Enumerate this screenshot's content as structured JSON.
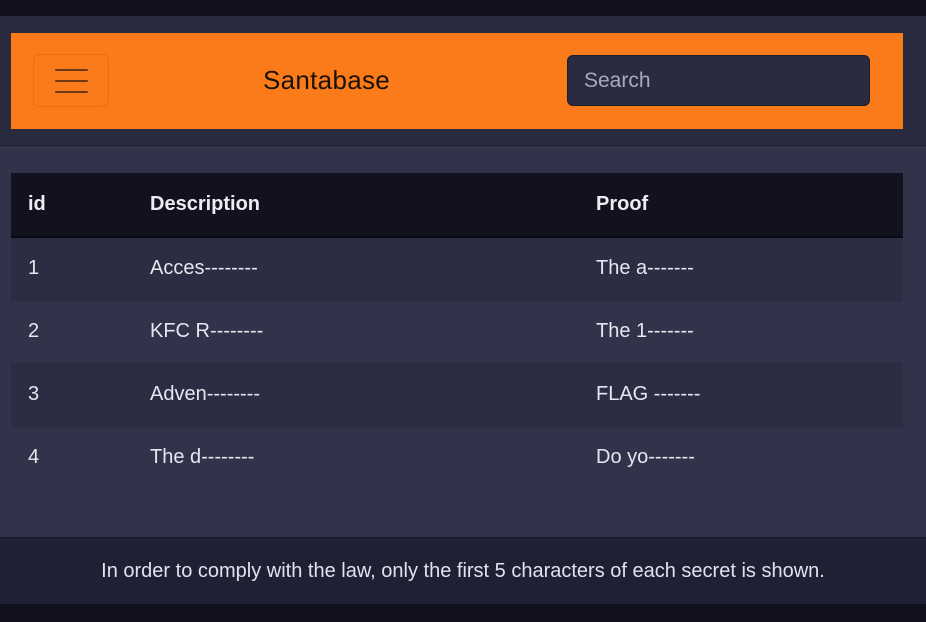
{
  "navbar": {
    "brand": "Santabase",
    "search_placeholder": "Search",
    "search_value": "",
    "accent_color": "#fb7a1a",
    "menu_icon": "hamburger-menu-icon"
  },
  "table": {
    "columns": [
      "id",
      "Description",
      "Proof"
    ],
    "rows": [
      {
        "id": "1",
        "description": "Acces--------",
        "proof": "The a-------"
      },
      {
        "id": "2",
        "description": "KFC R--------",
        "proof": "The 1-------"
      },
      {
        "id": "3",
        "description": "Adven--------",
        "proof": "FLAG -------"
      },
      {
        "id": "4",
        "description": "The d--------",
        "proof": "Do yo-------"
      }
    ]
  },
  "footer": {
    "notice": "In order to comply with the law, only the first 5 characters of each secret is shown."
  }
}
